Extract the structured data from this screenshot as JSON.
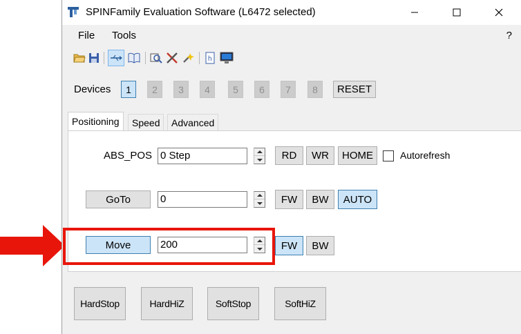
{
  "window": {
    "title": "SPINFamily Evaluation Software (L6472 selected)",
    "controls": [
      "minimize",
      "maximize",
      "close"
    ]
  },
  "menu": {
    "file": "File",
    "tools": "Tools",
    "help": "?"
  },
  "toolbar": {
    "icons": [
      "folder-open-icon",
      "save-icon",
      "usb-connect-icon",
      "manual-icon",
      "inspect-icon",
      "tools-icon",
      "wand-icon",
      "header-file-icon",
      "terminal-icon"
    ],
    "selected": "usb-connect-icon"
  },
  "devices": {
    "label": "Devices",
    "items": [
      "1",
      "2",
      "3",
      "4",
      "5",
      "6",
      "7",
      "8"
    ],
    "active": "1",
    "reset_label": "RESET"
  },
  "tabs": [
    "Positioning",
    "Speed",
    "Advanced"
  ],
  "active_tab": "Positioning",
  "positioning": {
    "abs_pos": {
      "label": "ABS_POS",
      "value": "0 Step",
      "rd": "RD",
      "wr": "WR",
      "home": "HOME",
      "autorefresh_label": "Autorefresh",
      "autorefresh_checked": false
    },
    "goto": {
      "button": "GoTo",
      "value": "0",
      "fw": "FW",
      "bw": "BW",
      "auto": "AUTO",
      "selected": "AUTO"
    },
    "move": {
      "button": "Move",
      "value": "200",
      "fw": "FW",
      "bw": "BW",
      "selected": "FW"
    }
  },
  "stop_buttons": {
    "hard_stop": "HardStop",
    "hard_hiz": "HardHiZ",
    "soft_stop": "SoftStop",
    "soft_hiz": "SoftHiZ"
  },
  "annotation": {
    "color": "#e8150b"
  }
}
